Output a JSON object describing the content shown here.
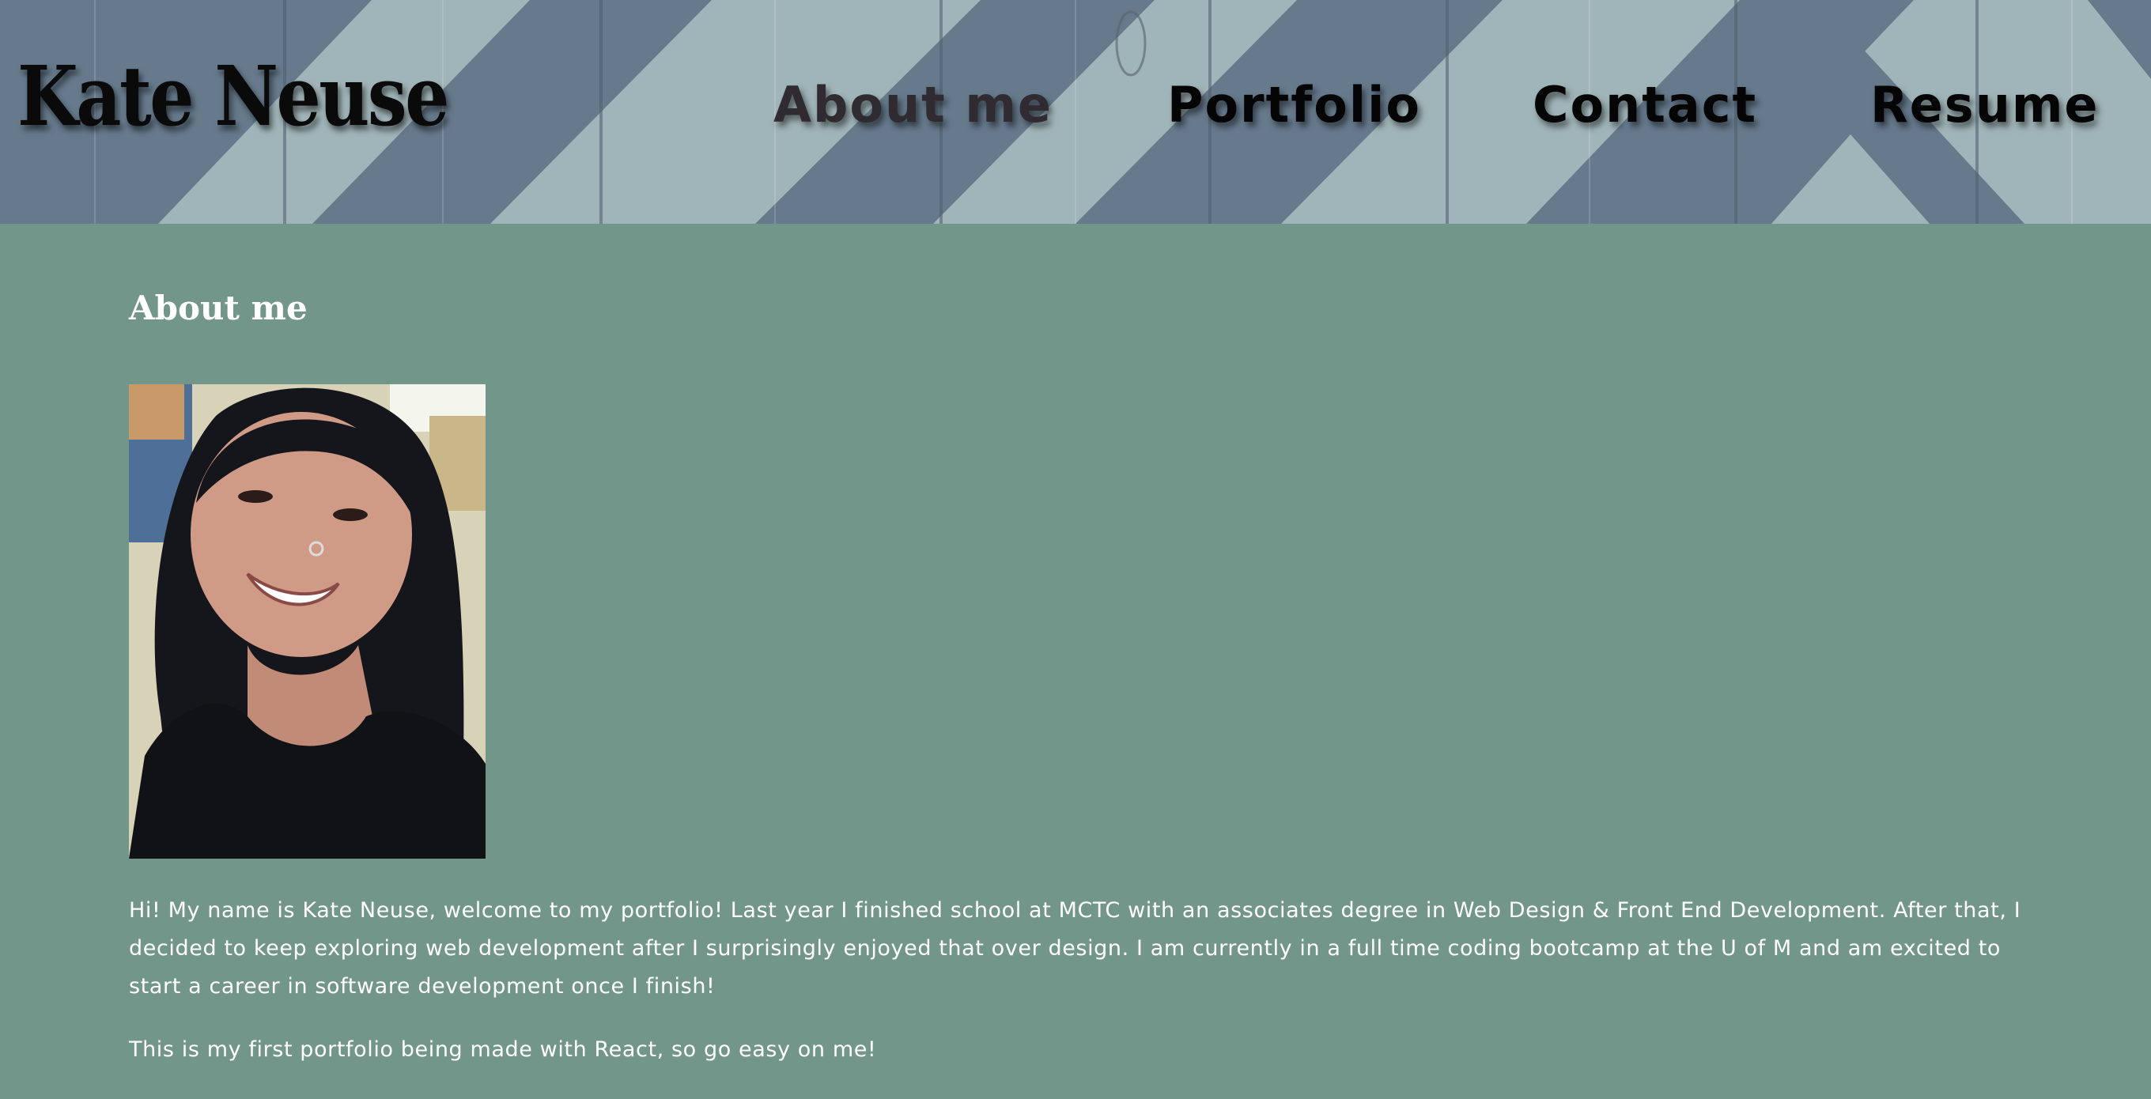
{
  "header": {
    "brand": "Kate Neuse",
    "nav": [
      {
        "label": "About me",
        "active": true
      },
      {
        "label": "Portfolio",
        "active": false
      },
      {
        "label": "Contact",
        "active": false
      },
      {
        "label": "Resume",
        "active": false
      }
    ]
  },
  "main": {
    "title": "About me",
    "paragraphs": [
      "Hi! My name is Kate Neuse, welcome to my portfolio! Last year I finished school at MCTC with an associates degree in Web Design & Front End Development. After that, I decided to keep exploring web development after I surprisingly enjoyed that over design. I am currently in a full time coding bootcamp at the U of M and am excited to start a career in software development once I finish!",
      "This is my first portfolio being made with React, so go easy on me!"
    ]
  },
  "colors": {
    "page_background": "#72968a",
    "header_light": "#9fb4b8",
    "header_dark": "#667a8c",
    "text": "#ffffff"
  }
}
